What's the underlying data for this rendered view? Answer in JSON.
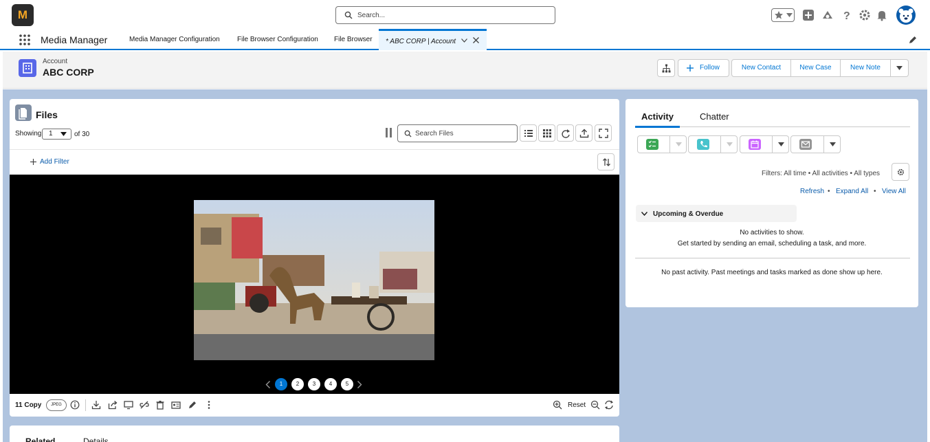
{
  "header": {
    "logo_text": "M",
    "search_placeholder": "Search..."
  },
  "nav": {
    "app_name": "Media Manager",
    "tabs": [
      {
        "label": "Media Manager Configuration"
      },
      {
        "label": "File Browser Configuration"
      },
      {
        "label": "File Browser"
      },
      {
        "label": "* ABC CORP | Account"
      }
    ]
  },
  "record": {
    "type": "Account",
    "name": "ABC CORP",
    "follow_label": "Follow",
    "actions": [
      "New Contact",
      "New Case",
      "New Note"
    ]
  },
  "files": {
    "title": "Files",
    "showing_label": "Showing",
    "page_value": "1",
    "of_label": "of 30",
    "search_placeholder": "Search Files",
    "add_filter_label": "Add Filter",
    "pages": [
      "1",
      "2",
      "3",
      "4",
      "5"
    ],
    "current_page": "1",
    "file_name": "11 Copy",
    "file_type": "JPEG",
    "reset_label": "Reset"
  },
  "bottom_tabs": [
    "Related",
    "Details"
  ],
  "activity": {
    "tabs": [
      "Activity",
      "Chatter"
    ],
    "filters_text": "Filters: All time • All activities • All types",
    "links": [
      "Refresh",
      "Expand All",
      "View All"
    ],
    "upcoming_label": "Upcoming & Overdue",
    "no_activities": "No activities to show.",
    "get_started": "Get started by sending an email, scheduling a task, and more.",
    "no_past": "No past activity. Past meetings and tasks marked as done show up here."
  },
  "colors": {
    "brand": "#0176d3",
    "account_icon": "#5867e8",
    "task_green": "#3ba755",
    "call_teal": "#48c3cc",
    "event_pink": "#cb65ff",
    "email_grey": "#939393"
  }
}
